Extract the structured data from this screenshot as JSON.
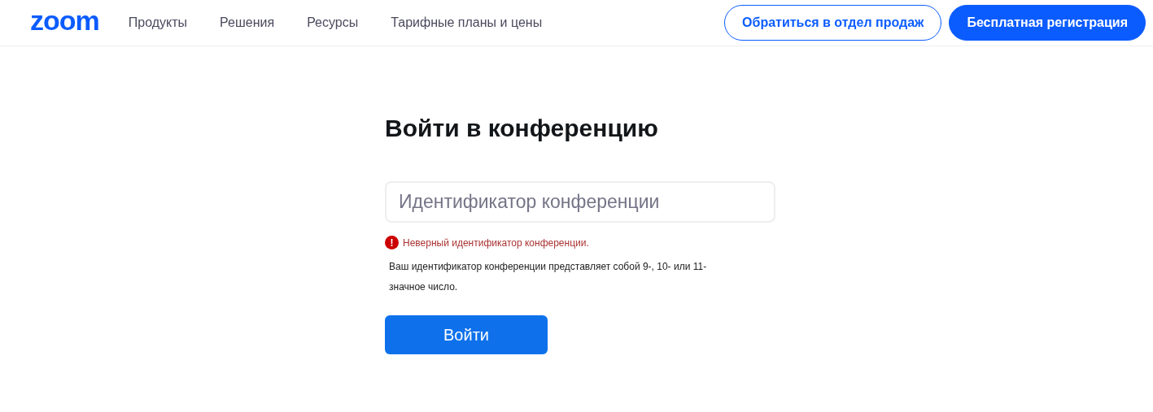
{
  "header": {
    "logo": "zoom",
    "nav": [
      "Продукты",
      "Решения",
      "Ресурсы",
      "Тарифные планы и цены"
    ],
    "buttons": [
      {
        "label": "Обратиться в отдел продаж",
        "kind": "outline"
      },
      {
        "label": "Бесплатная регистрация",
        "kind": "filled"
      }
    ]
  },
  "form": {
    "title": "Войти в конференцию",
    "field": {
      "placeholder": "Идентификатор конференции"
    },
    "error": {
      "icon": "!",
      "text": "Неверный идентификатор конференции."
    },
    "hint": "Ваш идентификатор конференции представляет собой 9-, 10- или 11-значное число.",
    "submit": "Войти"
  }
}
